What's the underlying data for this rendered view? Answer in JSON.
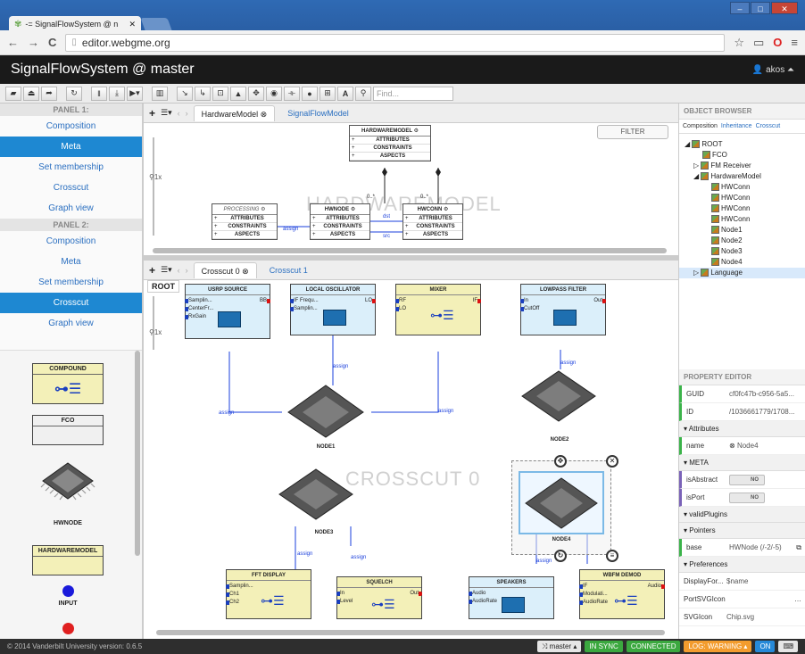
{
  "browser": {
    "tab_title": "-= SignalFlowSystem @ n",
    "url": "editor.webgme.org"
  },
  "app": {
    "title": "SignalFlowSystem @ master",
    "user": "akos"
  },
  "toolbar": {
    "find_placeholder": "Find..."
  },
  "left_panel": {
    "panel1_title": "PANEL 1:",
    "panel1_items": [
      "Composition",
      "Meta",
      "Set membership",
      "Crosscut",
      "Graph view"
    ],
    "panel2_title": "PANEL 2:",
    "panel2_items": [
      "Composition",
      "Meta",
      "Set membership",
      "Crosscut",
      "Graph view"
    ],
    "parts": [
      "COMPOUND",
      "FCO",
      "HWNODE",
      "HARDWAREMODEL",
      "INPUT"
    ]
  },
  "top_pane": {
    "tabs": [
      "HardwareModel",
      "SignalFlowModel"
    ],
    "filter_label": "FILTER",
    "zoom_label": "1x",
    "watermark": "HARDWAREMODEL",
    "uml_rows": [
      "ATTRIBUTES",
      "CONSTRAINTS",
      "ASPECTS"
    ],
    "boxes": [
      "HARDWAREMODEL",
      "PROCESSING",
      "HWNODE",
      "HWCONN"
    ],
    "edge_labels": [
      "assign",
      "dst",
      "src",
      "0..*",
      "0..*"
    ]
  },
  "bottom_pane": {
    "root_label": "ROOT",
    "tabs": [
      "Crosscut 0",
      "Crosscut 1"
    ],
    "zoom_label": "1x",
    "watermark": "CROSSCUT 0",
    "components": [
      {
        "title": "USRP SOURCE",
        "ports_in": [
          "Samplin...",
          "CenterFr...",
          "RxGain"
        ],
        "ports_out": [
          "BB"
        ]
      },
      {
        "title": "LOCAL OSCILLATOR",
        "ports_in": [
          "IF Frequ...",
          "Samplin..."
        ],
        "ports_out": [
          "LO"
        ]
      },
      {
        "title": "MIXER",
        "ports_in": [
          "RF",
          "LO"
        ],
        "ports_out": [
          "IF"
        ]
      },
      {
        "title": "LOWPASS FILTER",
        "ports_in": [
          "In",
          "CutOff"
        ],
        "ports_out": [
          "Out"
        ]
      },
      {
        "title": "FFT DISPLAY",
        "ports_in": [
          "Samplin...",
          "Ch1",
          "Ch2"
        ],
        "ports_out": []
      },
      {
        "title": "SQUELCH",
        "ports_in": [
          "In",
          "Level"
        ],
        "ports_out": [
          "Out"
        ]
      },
      {
        "title": "SPEAKERS",
        "ports_in": [
          "Audio",
          "AudioRate"
        ],
        "ports_out": []
      },
      {
        "title": "WBFM DEMOD",
        "ports_in": [
          "IF",
          "Modulati...",
          "AudioRate"
        ],
        "ports_out": [
          "Audio"
        ]
      }
    ],
    "nodes": [
      "NODE1",
      "NODE2",
      "NODE3",
      "NODE4"
    ],
    "edge_label": "assign"
  },
  "object_browser": {
    "title": "OBJECT BROWSER",
    "tabs": [
      "Composition",
      "Inheritance",
      "Crosscut"
    ],
    "tree": [
      "ROOT",
      "FCO",
      "FM Receiver",
      "HardwareModel",
      "HWConn",
      "HWConn",
      "HWConn",
      "HWConn",
      "Node1",
      "Node2",
      "Node3",
      "Node4",
      "Language"
    ]
  },
  "property_editor": {
    "title": "PROPERTY EDITOR",
    "guid_key": "GUID",
    "guid_value": "cf0fc47b-c956-5a5...",
    "id_key": "ID",
    "id_value": "/1036661779/1708...",
    "attributes_label": "Attributes",
    "name_key": "name",
    "name_value": "Node4",
    "meta_label": "META",
    "is_abstract_key": "isAbstract",
    "is_abstract_value": "NO",
    "is_port_key": "isPort",
    "is_port_value": "NO",
    "valid_plugins_label": "validPlugins",
    "pointers_label": "Pointers",
    "base_key": "base",
    "base_value": "HWNode (/-2/-5)",
    "preferences_label": "Preferences",
    "display_key": "DisplayFor...",
    "display_value": "$name",
    "port_svg_key": "PortSVGIcon",
    "svg_icon_key": "SVGIcon",
    "svg_icon_value": "Chip.svg"
  },
  "footer": {
    "copyright": "© 2014 Vanderbilt University version: 0.6.5",
    "branch": "master",
    "sync": "IN SYNC",
    "connected": "CONNECTED",
    "log": "LOG: WARNING",
    "on": "ON"
  },
  "colors": {
    "accent": "#1e88d2",
    "header_bg": "#1a1a1a",
    "component_blue": "#dbeffa",
    "component_yellow": "#f3f0b8",
    "status_green": "#3ba83f",
    "status_orange": "#f39c2e"
  }
}
